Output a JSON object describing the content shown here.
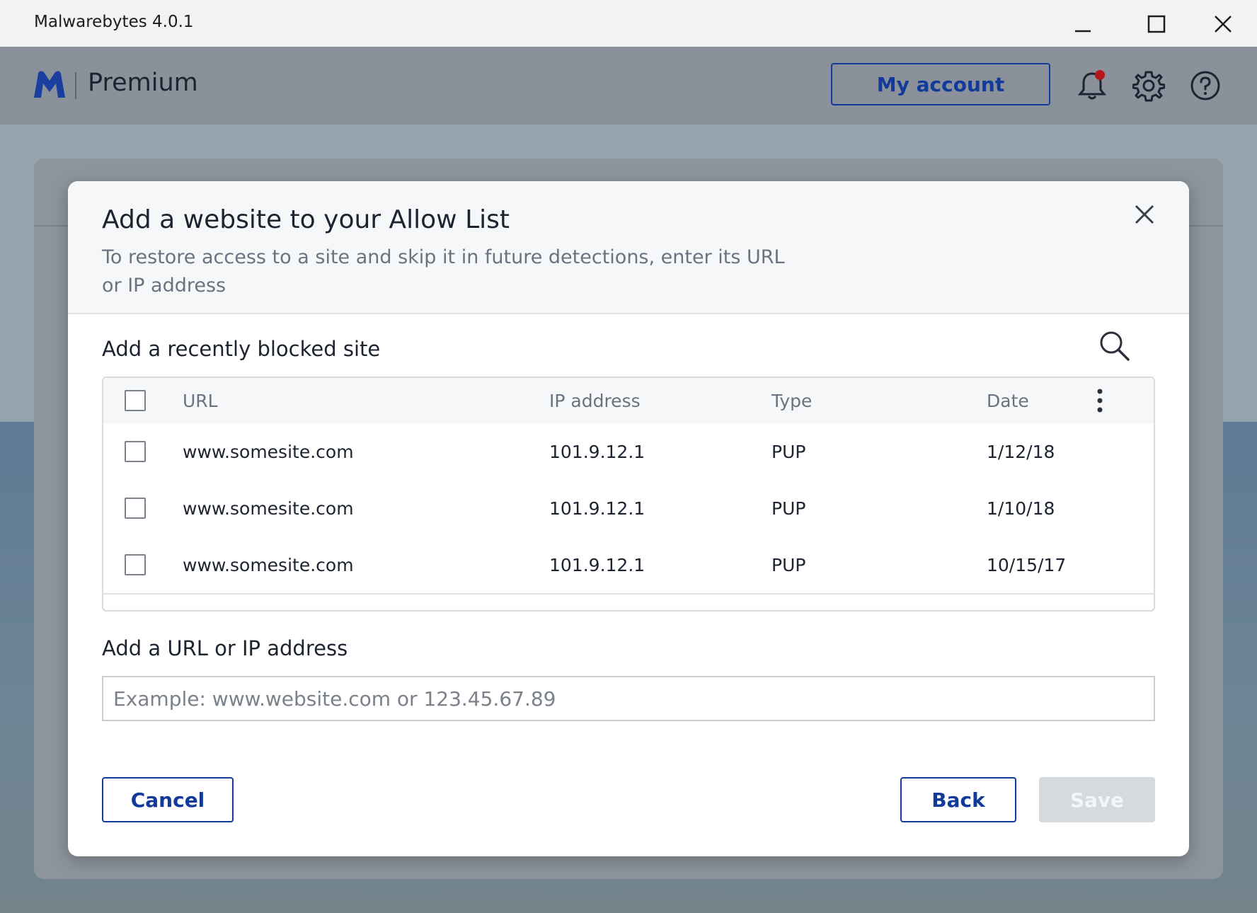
{
  "window": {
    "title": "Malwarebytes 4.0.1"
  },
  "header": {
    "brand": "Premium",
    "account_label": "My account",
    "notification_color": "#b5161b",
    "accent_color": "#123a9b"
  },
  "modal": {
    "title": "Add a website to your Allow List",
    "subtitle": "To restore access to a site and skip it in future detections, enter its URL or IP address",
    "recent_title": "Add a recently blocked site",
    "table": {
      "columns": [
        "URL",
        "IP address",
        "Type",
        "Date"
      ],
      "rows": [
        {
          "url": "www.somesite.com",
          "ip": "101.9.12.1",
          "type": "PUP",
          "date": "1/12/18"
        },
        {
          "url": "www.somesite.com",
          "ip": "101.9.12.1",
          "type": "PUP",
          "date": "1/10/18"
        },
        {
          "url": "www.somesite.com",
          "ip": "101.9.12.1",
          "type": "PUP",
          "date": "10/15/17"
        }
      ]
    },
    "manual_title": "Add a URL or IP address",
    "input": {
      "value": "",
      "placeholder": "Example: www.website.com or 123.45.67.89"
    },
    "buttons": {
      "cancel": "Cancel",
      "back": "Back",
      "save": "Save"
    }
  }
}
